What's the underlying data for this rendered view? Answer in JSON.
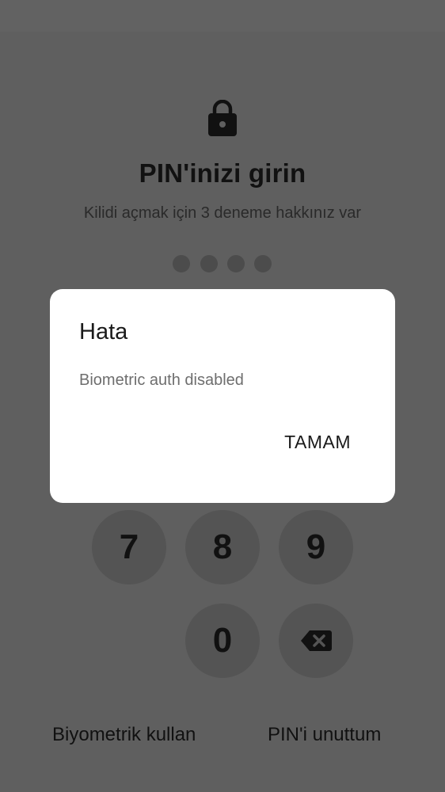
{
  "pin_screen": {
    "title": "PIN'inizi girin",
    "subtitle": "Kilidi açmak için 3 deneme hakkınız var",
    "pin_length": 4,
    "filled_digits": 0,
    "icons": {
      "lock": "lock-icon",
      "backspace": "backspace-icon"
    },
    "keypad": {
      "visible_keys": [
        "7",
        "8",
        "9",
        "0"
      ]
    },
    "biometric_link": "Biyometrik kullan",
    "forgot_link": "PIN'i unuttum"
  },
  "dialog": {
    "title": "Hata",
    "message": "Biometric auth disabled",
    "button_label": "TAMAM"
  },
  "colors": {
    "scrim": "#5f5f5f",
    "dialog_background": "#ffffff",
    "text_dark": "#111111",
    "dialog_message": "#6e6e6e"
  }
}
